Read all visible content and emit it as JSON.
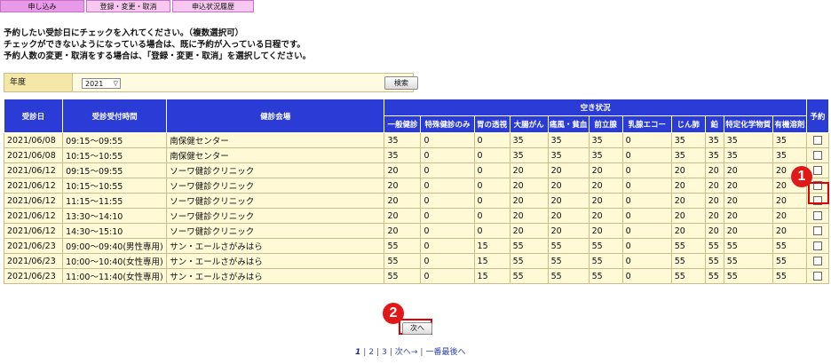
{
  "tabs": [
    {
      "label": "申し込み"
    },
    {
      "label": "登録・変更・取消"
    },
    {
      "label": "申込状況履歴"
    }
  ],
  "intro": [
    "予約したい受診日にチェックを入れてください。（複数選択可）",
    "チェックができないようになっている場合は、既に予約が入っている日程です。",
    "予約人数の変更・取消をする場合は、「登録・変更・取消」を選択してください。"
  ],
  "search": {
    "label": "年度",
    "year_value": "2021",
    "button": "検索"
  },
  "table": {
    "headers": {
      "date": "受診日",
      "time": "受診受付時間",
      "venue": "健診会場",
      "availability": "空き状況",
      "reserve": "予約"
    },
    "sub_headers": [
      "一般健診",
      "特殊健診のみ",
      "胃の透視",
      "大腸がん",
      "痛風・貧血",
      "前立腺",
      "乳腺エコー",
      "じん肺",
      "鉛",
      "特定化学物質",
      "有機溶剤"
    ],
    "rows": [
      {
        "date": "2021/06/08",
        "time": "09:15～09:55",
        "venue": "南保健センター",
        "v": [
          "35",
          "0",
          "0",
          "35",
          "35",
          "35",
          "0",
          "35",
          "35",
          "35",
          "35"
        ]
      },
      {
        "date": "2021/06/08",
        "time": "10:15～10:55",
        "venue": "南保健センター",
        "v": [
          "35",
          "0",
          "0",
          "35",
          "35",
          "35",
          "0",
          "35",
          "35",
          "35",
          "35"
        ]
      },
      {
        "date": "2021/06/12",
        "time": "09:15～09:55",
        "venue": "ソーワ健診クリニック",
        "v": [
          "20",
          "0",
          "0",
          "20",
          "20",
          "20",
          "0",
          "20",
          "20",
          "20",
          "20"
        ]
      },
      {
        "date": "2021/06/12",
        "time": "10:15～10:55",
        "venue": "ソーワ健診クリニック",
        "v": [
          "20",
          "0",
          "0",
          "20",
          "20",
          "20",
          "0",
          "20",
          "20",
          "20",
          "20"
        ]
      },
      {
        "date": "2021/06/12",
        "time": "11:15～11:55",
        "venue": "ソーワ健診クリニック",
        "v": [
          "20",
          "0",
          "0",
          "20",
          "20",
          "20",
          "0",
          "20",
          "20",
          "20",
          "20"
        ]
      },
      {
        "date": "2021/06/12",
        "time": "13:30～14:10",
        "venue": "ソーワ健診クリニック",
        "v": [
          "20",
          "0",
          "0",
          "20",
          "20",
          "20",
          "0",
          "20",
          "20",
          "20",
          "20"
        ]
      },
      {
        "date": "2021/06/12",
        "time": "14:30～15:10",
        "venue": "ソーワ健診クリニック",
        "v": [
          "20",
          "0",
          "0",
          "20",
          "20",
          "20",
          "0",
          "20",
          "20",
          "20",
          "20"
        ]
      },
      {
        "date": "2021/06/23",
        "time": "09:00～09:40(男性専用)",
        "venue": "サン・エールさがみはら",
        "v": [
          "55",
          "0",
          "15",
          "55",
          "55",
          "55",
          "0",
          "55",
          "55",
          "55",
          "55"
        ]
      },
      {
        "date": "2021/06/23",
        "time": "10:00～10:40(女性専用)",
        "venue": "サン・エールさがみはら",
        "v": [
          "55",
          "0",
          "15",
          "55",
          "55",
          "55",
          "0",
          "55",
          "55",
          "55",
          "55"
        ]
      },
      {
        "date": "2021/06/23",
        "time": "11:00～11:40(女性専用)",
        "venue": "サン・エールさがみはら",
        "v": [
          "55",
          "0",
          "15",
          "55",
          "55",
          "55",
          "0",
          "55",
          "55",
          "55",
          "55"
        ]
      }
    ]
  },
  "next_button": "次へ",
  "badges": [
    "1",
    "2"
  ],
  "pager": {
    "current": "1",
    "pages": [
      "2",
      "3"
    ],
    "next": "次へ→",
    "last": "一番最後へ"
  },
  "colors": {
    "header_blue": "#2a3bd6",
    "cell_bg": "#fff9d6",
    "tab_active": "#e89ae8",
    "tab": "#f7c8f0",
    "highlight": "#e10000"
  }
}
